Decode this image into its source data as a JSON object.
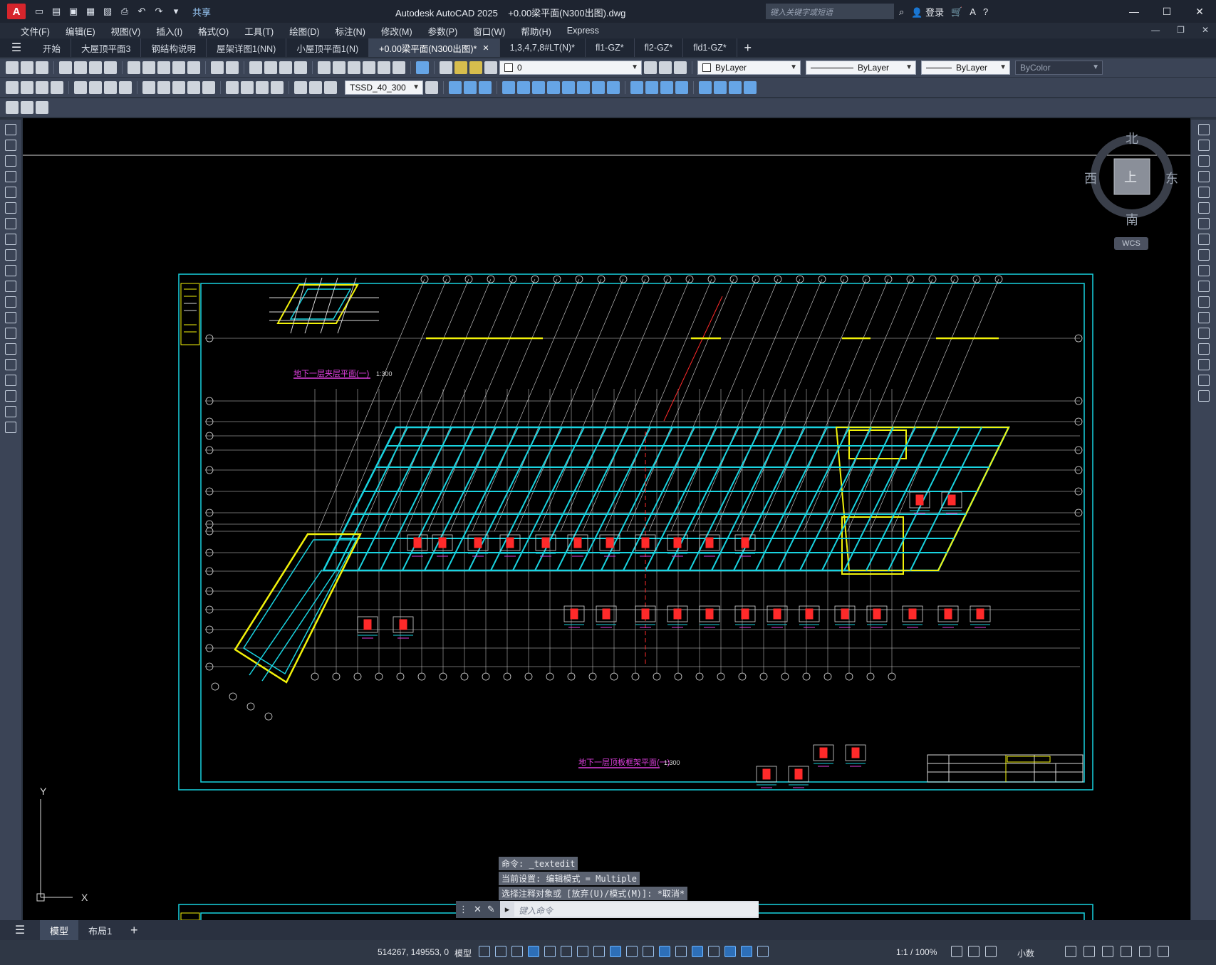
{
  "app": {
    "logo": "A",
    "title": "Autodesk AutoCAD 2025",
    "document": "+0.00梁平面(N300出图).dwg",
    "share": "共享",
    "search_placeholder": "键入关键字或短语",
    "login": "登录",
    "window_controls": [
      "—",
      "☐",
      "✕"
    ]
  },
  "menu": [
    "文件(F)",
    "编辑(E)",
    "视图(V)",
    "插入(I)",
    "格式(O)",
    "工具(T)",
    "绘图(D)",
    "标注(N)",
    "修改(M)",
    "参数(P)",
    "窗口(W)",
    "帮助(H)",
    "Express"
  ],
  "doc_tabs": [
    {
      "label": "开始",
      "active": false
    },
    {
      "label": "大屋顶平面3",
      "active": false
    },
    {
      "label": "钢结构说明",
      "active": false
    },
    {
      "label": "屋架详图1(NN)",
      "active": false
    },
    {
      "label": "小屋顶平面1(N)",
      "active": false
    },
    {
      "label": "+0.00梁平面(N300出图)*",
      "active": true
    },
    {
      "label": "1,3,4,7,8#LT(N)*",
      "active": false
    },
    {
      "label": "fl1-GZ*",
      "active": false
    },
    {
      "label": "fl2-GZ*",
      "active": false
    },
    {
      "label": "fld1-GZ*",
      "active": false
    }
  ],
  "properties": {
    "layer": "0",
    "color": "ByLayer",
    "linetype": "ByLayer",
    "lineweight": "ByLayer",
    "plotstyle": "ByColor",
    "dimstyle": "TSSD_40_300"
  },
  "viewcube": {
    "north": "北",
    "south": "南",
    "east": "东",
    "west": "西",
    "top": "上",
    "wcs": "WCS"
  },
  "drawing": {
    "title_main": "地下一层顶板框架平面(一)",
    "scale_main": "1:300",
    "title_inset": "地下一层夹层平面(一)",
    "scale_inset": "1:300",
    "ucs_y": "Y",
    "ucs_x": "X"
  },
  "command": {
    "history": [
      "命令: _textedit",
      "当前设置: 编辑模式 = Multiple",
      "选择注释对象或 [放弃(U)/模式(M)]: *取消*"
    ],
    "placeholder": "键入命令"
  },
  "layout_tabs": [
    {
      "label": "模型",
      "active": true
    },
    {
      "label": "布局1",
      "active": false
    }
  ],
  "status": {
    "coords": "514267, 149553, 0",
    "model": "模型",
    "scale": "1:1 / 100%",
    "units": "小数"
  },
  "colors": {
    "cyan": "#19d3e0",
    "yellow": "#f2f20a",
    "magenta": "#e040e0",
    "red": "#ff2a2a",
    "white": "#d8d8d8"
  }
}
